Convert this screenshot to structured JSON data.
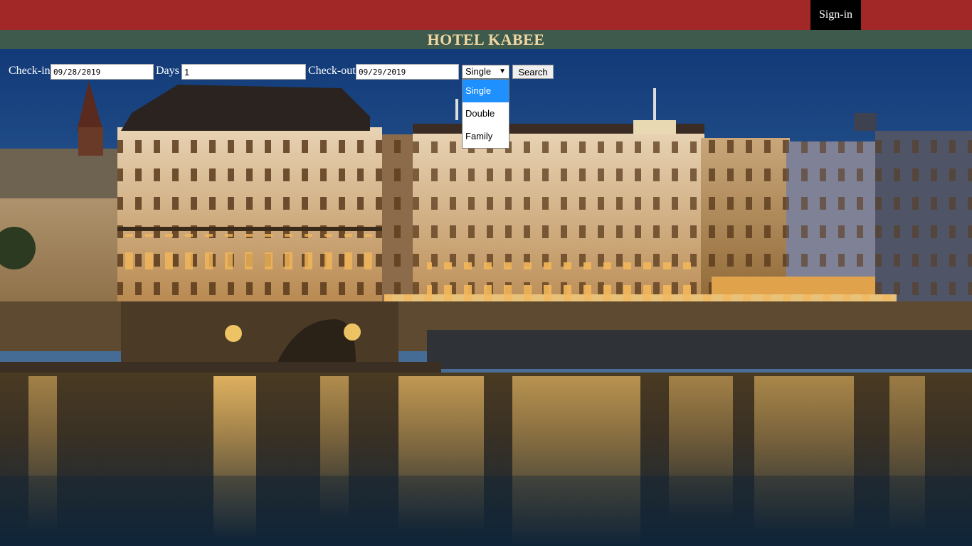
{
  "header": {
    "signin_label": "Sign-in"
  },
  "title": "HOTEL KABEE",
  "form": {
    "checkin_label": "Check-in",
    "checkin_value": "09/28/2019",
    "days_label": "Days",
    "days_value": "1",
    "checkout_label": "Check-out",
    "checkout_value": "09/29/2019",
    "room_type_selected": "Single",
    "search_label": "Search"
  },
  "dropdown": {
    "options": [
      "Single",
      "Double",
      "Family"
    ],
    "highlighted_index": 0
  },
  "icons": {
    "select_arrow": "chevron-down-icon"
  },
  "colors": {
    "topbar": "#a22828",
    "titlebar": "#3d5a4c",
    "title_text": "#f1d7a3",
    "signin_bg": "#000000",
    "option_highlight": "#1e90ff"
  }
}
